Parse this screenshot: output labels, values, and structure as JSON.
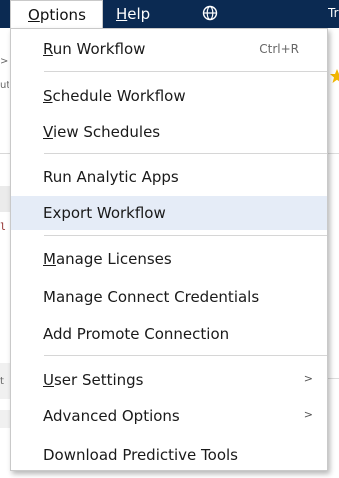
{
  "menubar": {
    "options": {
      "accel": "O",
      "rest": "ptions"
    },
    "help": {
      "accel": "H",
      "rest": "elp"
    },
    "globe_icon": "globe-icon",
    "edge_text": "Tr",
    "background_color": "#0b2a52"
  },
  "background": {
    "frag1": ">",
    "frag2": "ut",
    "frag3": "l",
    "frag4": "t",
    "star_color": "#f2b600"
  },
  "menu": {
    "run_workflow": {
      "accel": "R",
      "rest": "un Workflow",
      "shortcut": "Ctrl+R"
    },
    "schedule_workflow": {
      "accel": "S",
      "rest": "chedule Workflow"
    },
    "view_schedules": {
      "accel": "V",
      "rest": "iew Schedules"
    },
    "run_analytic_apps": {
      "label": "Run Analytic Apps"
    },
    "export_workflow": {
      "label": "Export Workflow"
    },
    "manage_licenses": {
      "accel": "M",
      "rest": "anage Licenses"
    },
    "manage_connect_credentials": {
      "label": "Manage Connect Credentials"
    },
    "add_promote_connection": {
      "label": "Add Promote Connection"
    },
    "user_settings": {
      "accel": "U",
      "rest": "ser Settings",
      "arrow": ">"
    },
    "advanced_options": {
      "label": "Advanced Options",
      "arrow": ">"
    },
    "download_predictive_tools": {
      "label": "Download Predictive Tools"
    },
    "highlight_color": "#e5ecf7"
  }
}
